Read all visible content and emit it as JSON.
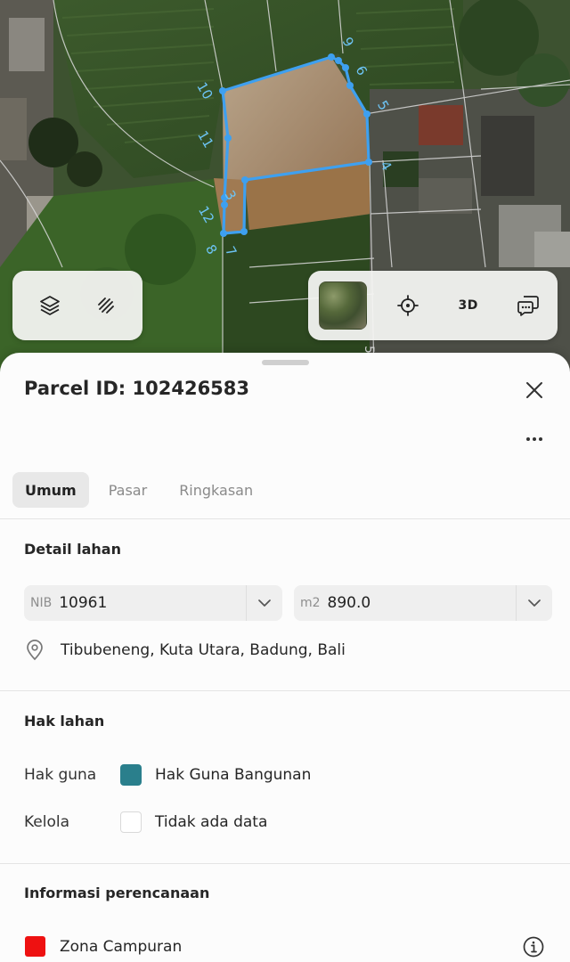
{
  "map": {
    "vertex_labels": [
      "10",
      "11",
      "3",
      "12",
      "9",
      "6",
      "5",
      "4",
      "8",
      "7"
    ],
    "road_label": "5",
    "colors": {
      "parcel_outline": "#3ea0f0",
      "label": "#6dc4f5"
    },
    "controls_left": [
      {
        "icon": "layers-icon"
      },
      {
        "icon": "draw-icon"
      }
    ],
    "controls_right": [
      {
        "icon": "satellite-thumbnail"
      },
      {
        "icon": "locate-icon"
      },
      {
        "label": "3D"
      },
      {
        "icon": "feedback-icon"
      }
    ]
  },
  "sheet": {
    "title": "Parcel ID: 102426583",
    "tabs": [
      {
        "label": "Umum",
        "active": true
      },
      {
        "label": "Pasar",
        "active": false
      },
      {
        "label": "Ringkasan",
        "active": false
      }
    ],
    "detail": {
      "heading": "Detail lahan",
      "nib": {
        "prefix": "NIB",
        "value": "10961"
      },
      "area": {
        "prefix": "m2",
        "value": "890.0"
      },
      "location": "Tibubeneng, Kuta Utara, Badung, Bali"
    },
    "hak": {
      "heading": "Hak lahan",
      "rows": [
        {
          "key": "Hak guna",
          "value": "Hak Guna Bangunan",
          "color": "#2a7f8c"
        },
        {
          "key": "Kelola",
          "value": "Tidak ada data",
          "color": "#ffffff"
        }
      ]
    },
    "planning": {
      "heading": "Informasi perencanaan",
      "zone": {
        "label": "Zona Campuran",
        "color": "#ee1111"
      }
    }
  }
}
